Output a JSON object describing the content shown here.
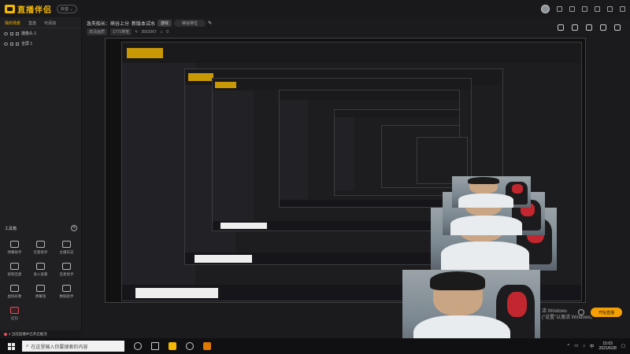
{
  "app": {
    "logo_text": "直播伴侣",
    "version_badge": "抖音 ⌄"
  },
  "left_panel": {
    "tabs": [
      {
        "label": "我的场景"
      },
      {
        "label": "直连"
      },
      {
        "label": "可添加"
      }
    ],
    "scenes": [
      {
        "label": "摄像头 1"
      },
      {
        "label": "全屏 1"
      }
    ],
    "tools_title": "工具箱",
    "tools_add": "+",
    "tools": [
      {
        "label": "弹幕助手",
        "icon": "danmaku-icon"
      },
      {
        "label": "信管助手",
        "icon": "manager-icon"
      },
      {
        "label": "主播日志",
        "icon": "calendar-icon"
      },
      {
        "label": "视频连麦",
        "icon": "video-icon"
      },
      {
        "label": "进入观看",
        "icon": "enter-icon"
      },
      {
        "label": "连麦助手",
        "icon": "link-icon"
      },
      {
        "label": "虚拟形象",
        "icon": "avatar-icon"
      },
      {
        "label": "弹幕墙",
        "icon": "wall-icon"
      },
      {
        "label": "数据助手",
        "icon": "data-icon"
      },
      {
        "label": "红包",
        "icon": "redpacket-icon"
      },
      {
        "label": "",
        "icon": "more-icon"
      },
      {
        "label": "",
        "icon": "more-icon"
      }
    ],
    "notice": "1 当前直播中已开启推流"
  },
  "header": {
    "live_title": "急失船长：峡谷上分",
    "live_title_suffix": "新版本试水",
    "category_tag": "游戏",
    "pill_label": "峡谷排位",
    "meta": [
      "高清画质",
      "1771带宽",
      "3552067",
      "0"
    ]
  },
  "preview": {
    "windows_tip_line1": "活 Windows",
    "windows_tip_line2": "(“设置”以激活 Windows。",
    "start_live_label": "开始直播"
  },
  "taskbar": {
    "search_placeholder": "在这里输入你要搜索的内容",
    "tray_lang": "中",
    "time": "15:03",
    "date": "2021/6/28"
  },
  "colors": {
    "accent": "#f5b800",
    "start_live": "#f5a000",
    "background": "#1b1b1d"
  }
}
